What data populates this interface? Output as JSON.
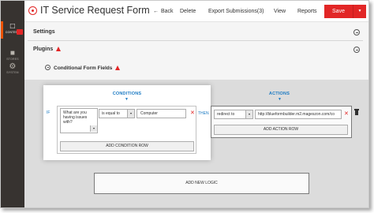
{
  "header": {
    "title": "IT Service Request Form",
    "back_label": "Back",
    "back_arrow": "←",
    "delete_label": "Delete",
    "export_label": "Export Submissions(3)",
    "view_label": "View",
    "reports_label": "Reports",
    "save_label": "Save",
    "save_split_glyph": "▼"
  },
  "admin_menu": {
    "items": [
      {
        "label": "CONTENT",
        "icon": "content-icon",
        "active": true
      },
      {
        "label": "STORES",
        "icon": "store-icon",
        "active": false
      },
      {
        "label": "SYSTEM",
        "icon": "gear-icon",
        "active": false
      }
    ],
    "badge_color": "#e22626"
  },
  "sections": {
    "settings": "Settings",
    "plugins": "Plugins"
  },
  "plugin": {
    "label": "Conditional Form Fields"
  },
  "conditions": {
    "header": "CONDITIONS",
    "if_label": "IF",
    "field_value": "What are you having issues with?",
    "operator_value": "is equal to",
    "compare_value": "Computer",
    "add_row_label": "ADD CONDITION ROW"
  },
  "then_label": "THEN",
  "actions": {
    "header": "ACTIONS",
    "action_value": "redirect to",
    "url_value": "http://blueformbuilder.m2.mageszon.com/co",
    "add_row_label": "ADD ACTION ROW"
  },
  "add_logic_label": "ADD NEW LOGIC",
  "glyphs": {
    "down_arrow": "▼",
    "remove": "✕",
    "caret": "▾"
  },
  "colors": {
    "brand_red": "#e22626",
    "accent_blue": "#1979c3",
    "menu_bg": "#373330"
  }
}
